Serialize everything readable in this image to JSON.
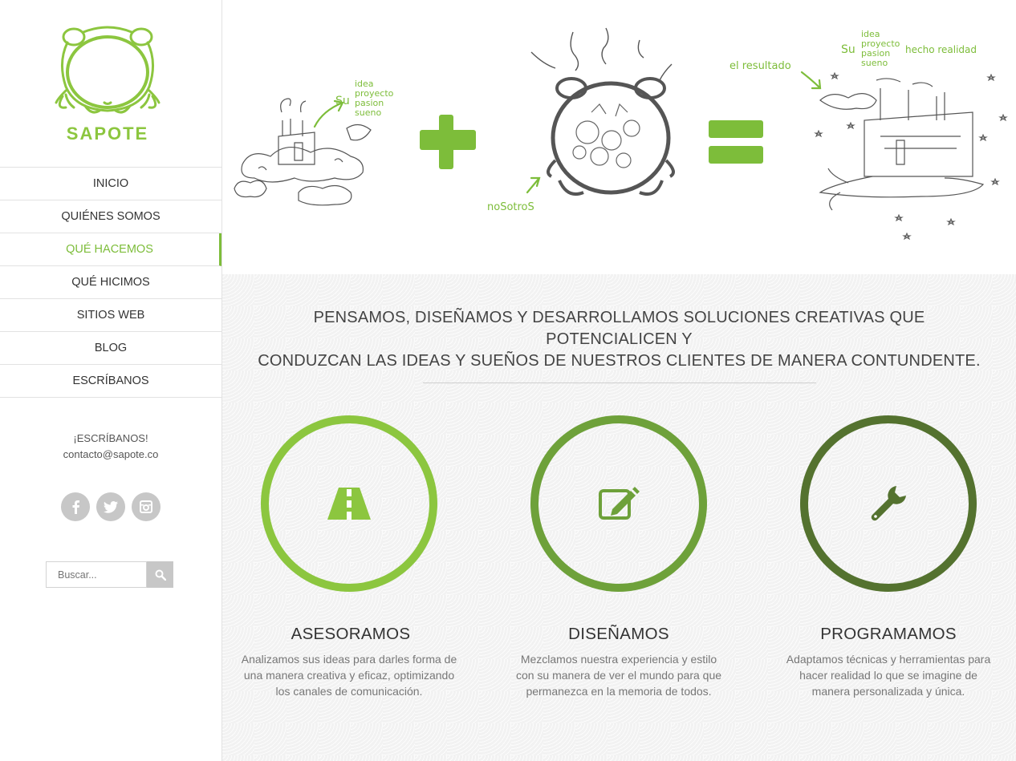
{
  "brand": {
    "name": "SAPOTE",
    "accent": "#8cc63f"
  },
  "nav": {
    "items": [
      {
        "label": "INICIO"
      },
      {
        "label": "QUIÉNES SOMOS"
      },
      {
        "label": "QUÉ HACEMOS",
        "active": true
      },
      {
        "label": "QUÉ HICIMOS"
      },
      {
        "label": "SITIOS WEB"
      },
      {
        "label": "BLOG"
      },
      {
        "label": "ESCRÍBANOS"
      }
    ]
  },
  "contact": {
    "heading": "¡ESCRÍBANOS!",
    "email": "contacto@sapote.co"
  },
  "social": {
    "icons": [
      "facebook-icon",
      "twitter-icon",
      "instagram-icon"
    ]
  },
  "search": {
    "placeholder": "Buscar..."
  },
  "hero": {
    "left_su": "Su",
    "left_words": [
      "idea",
      "proyecto",
      "pasion",
      "sueno"
    ],
    "middle_label": "noSotroS",
    "right_label": "el resultado",
    "right_su": "Su",
    "right_words": [
      "idea",
      "proyecto",
      "pasion",
      "sueno"
    ],
    "right_caption": "hecho realidad"
  },
  "mission": {
    "line1": "PENSAMOS, DISEÑAMOS Y DESARROLLAMOS SOLUCIONES CREATIVAS QUE POTENCIALICEN Y",
    "line2": "CONDUZCAN LAS IDEAS Y SUEÑOS DE NUESTROS CLIENTES DE MANERA CONTUNDENTE."
  },
  "services": [
    {
      "title": "ASESORAMOS",
      "icon": "road-icon",
      "color": "#8cc63f",
      "desc": "Analizamos sus ideas para darles forma de una manera creativa y eficaz, optimizando los canales de comunicación."
    },
    {
      "title": "DISEÑAMOS",
      "icon": "edit-icon",
      "color": "#6ea13a",
      "desc": "Mezclamos nuestra experiencia y estilo con su manera de ver el mundo para que permanezca en la memoria de todos."
    },
    {
      "title": "PROGRAMAMOS",
      "icon": "wrench-icon",
      "color": "#54722f",
      "desc": "Adaptamos técnicas y herramientas para hacer realidad lo que se imagine de manera personalizada y única."
    }
  ]
}
